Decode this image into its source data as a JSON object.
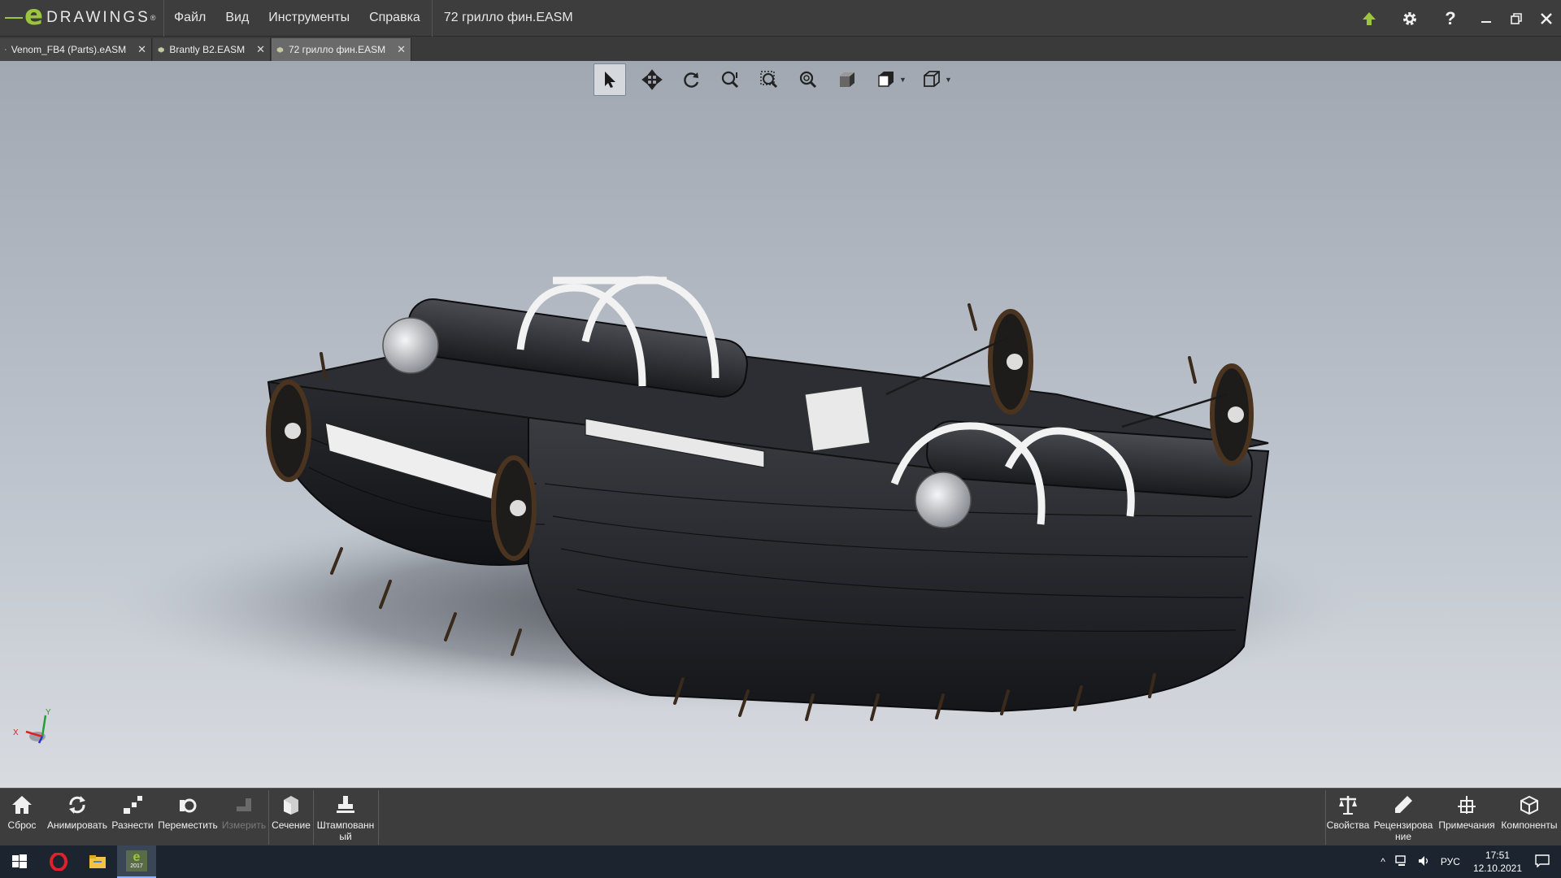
{
  "app": {
    "logo_letter": "e",
    "logo_text": "DRAWINGS",
    "logo_mark": "®"
  },
  "menu": [
    "Файл",
    "Вид",
    "Инструменты",
    "Справка"
  ],
  "title": "72 грилло фин.EASM",
  "tabs": [
    {
      "label": "Venom_FB4 (Parts).eASM",
      "active": false
    },
    {
      "label": "Brantly B2.EASM",
      "active": false
    },
    {
      "label": "72 грилло фин.EASM",
      "active": true
    }
  ],
  "view_tools": [
    "select-arrow-icon",
    "pan-icon",
    "rotate-icon",
    "zoom-in-out-icon",
    "zoom-to-area-icon",
    "zoom-to-fit-icon",
    "shaded-view-icon",
    "views-icon",
    "display-style-icon"
  ],
  "triad": {
    "x": "X",
    "y": "Y"
  },
  "commands_left": [
    {
      "label": "Сброс",
      "icon": "home-icon",
      "enabled": true
    },
    {
      "label": "Анимировать",
      "icon": "animate-icon",
      "enabled": true
    },
    {
      "label": "Разнести",
      "icon": "explode-icon",
      "enabled": true
    },
    {
      "label": "Переместить",
      "icon": "move-icon",
      "enabled": true
    },
    {
      "label": "Измерить",
      "icon": "measure-icon",
      "enabled": false
    },
    {
      "label": "Сечение",
      "icon": "section-icon",
      "enabled": true
    },
    {
      "label": "Штампованн ый",
      "icon": "stamp-icon",
      "enabled": true
    }
  ],
  "commands_right": [
    {
      "label": "Свойства",
      "icon": "balance-icon"
    },
    {
      "label": "Рецензирова ние",
      "icon": "pencil-icon"
    },
    {
      "label": "Примечания",
      "icon": "markup-icon"
    },
    {
      "label": "Компоненты",
      "icon": "components-icon"
    }
  ],
  "taskbar": {
    "lang": "РУС",
    "time": "17:51",
    "date": "12.10.2021",
    "eDrawings_badge": "2017"
  },
  "colors": {
    "accent_green": "#9bc53d",
    "titlebar": "#3d3d3d",
    "viewport_top": "#a1a8b2",
    "viewport_bottom": "#d8dbe0"
  }
}
